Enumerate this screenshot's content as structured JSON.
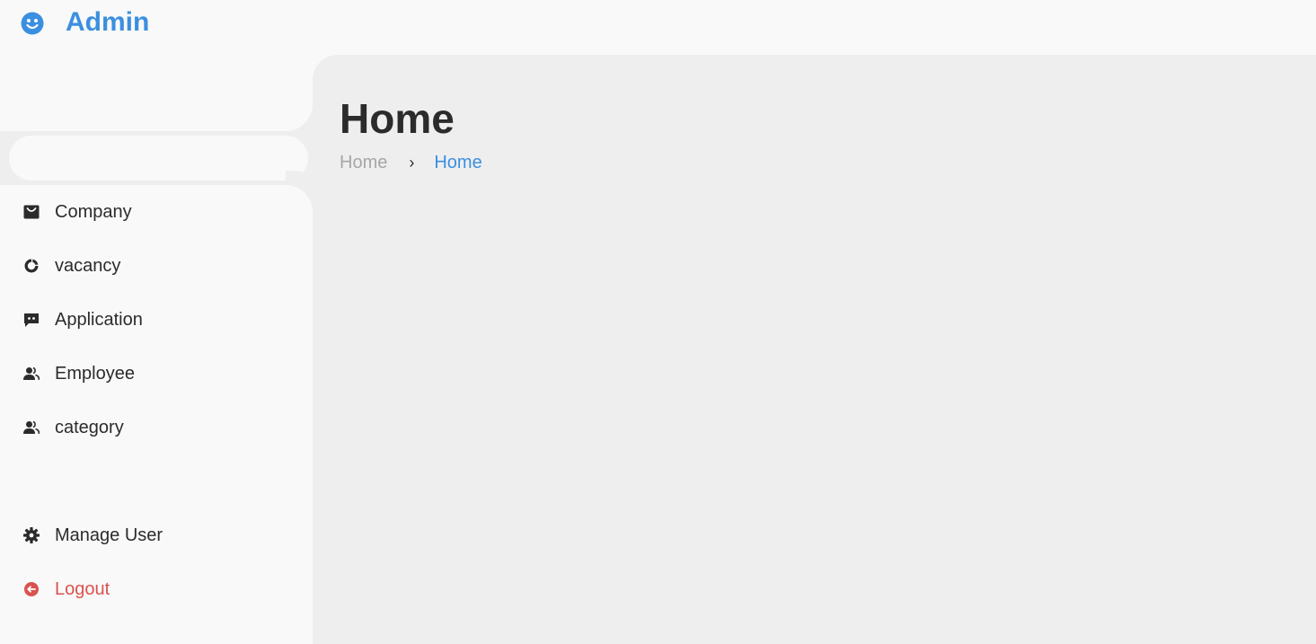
{
  "brand": {
    "title": "Admin",
    "icon": "smiley-icon",
    "color": "#3b8fe0"
  },
  "sidebar": {
    "items": [
      {
        "label": "Company",
        "icon": "shopping-bag-icon"
      },
      {
        "label": "vacancy",
        "icon": "pie-chart-icon"
      },
      {
        "label": "Application",
        "icon": "chat-bubble-icon"
      },
      {
        "label": "Employee",
        "icon": "people-icon"
      },
      {
        "label": "category",
        "icon": "people-icon"
      }
    ],
    "bottom_items": [
      {
        "label": "Manage User",
        "icon": "gear-icon"
      },
      {
        "label": "Logout",
        "icon": "logout-icon",
        "color": "#d9534f"
      }
    ]
  },
  "main": {
    "title": "Home",
    "breadcrumb": {
      "home": "Home",
      "separator": "›",
      "current": "Home"
    }
  }
}
